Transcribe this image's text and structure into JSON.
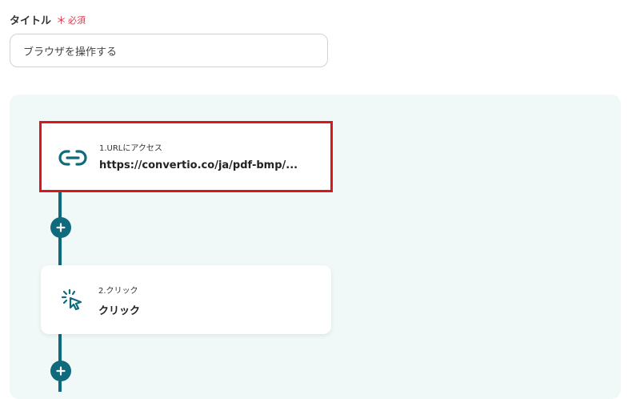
{
  "form": {
    "title_label": "タイトル",
    "required_mark": "＊",
    "required_text": "必須",
    "title_value": "ブラウザを操作する"
  },
  "flow": {
    "steps": [
      {
        "step_label": "1.URLにアクセス",
        "value": "https://convertio.co/ja/pdf-bmp/...",
        "icon": "link-icon",
        "highlighted": true
      },
      {
        "step_label": "2.クリック",
        "value": "クリック",
        "icon": "click-icon",
        "highlighted": false
      }
    ]
  },
  "colors": {
    "accent": "#0f6b7c",
    "required": "#e0344b",
    "highlight": "#d9181e",
    "canvas_bg": "#f0f8f8"
  }
}
